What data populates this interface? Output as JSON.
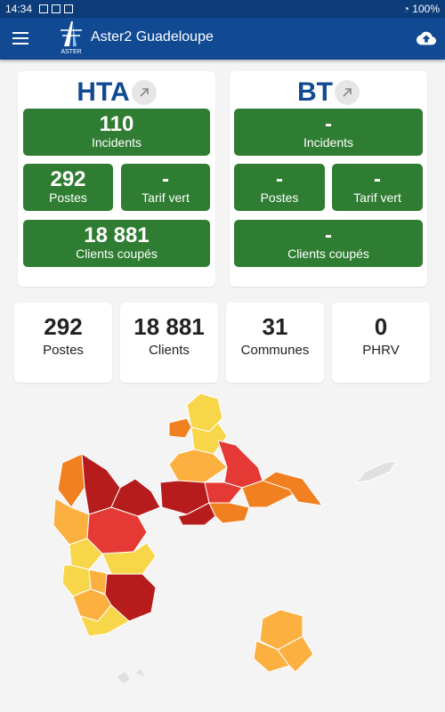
{
  "status_bar": {
    "time": "14:34",
    "battery": "100%"
  },
  "app": {
    "title": "Aster2  Guadeloupe",
    "logo_text": "ASTER"
  },
  "hta": {
    "title": "HTA",
    "incidents": {
      "value": "110",
      "label": "Incidents"
    },
    "postes": {
      "value": "292",
      "label": "Postes"
    },
    "tarif_vert": {
      "value": "-",
      "label": "Tarif vert"
    },
    "clients_coupes": {
      "value": "18 881",
      "label": "Clients coupés"
    }
  },
  "bt": {
    "title": "BT",
    "incidents": {
      "value": "-",
      "label": "Incidents"
    },
    "postes": {
      "value": "-",
      "label": "Postes"
    },
    "tarif_vert": {
      "value": "-",
      "label": "Tarif vert"
    },
    "clients_coupes": {
      "value": "-",
      "label": "Clients coupés"
    }
  },
  "stats": [
    {
      "value": "292",
      "label": "Postes"
    },
    {
      "value": "18 881",
      "label": "Clients"
    },
    {
      "value": "31",
      "label": "Communes"
    },
    {
      "value": "0",
      "label": "PHRV"
    }
  ],
  "colors": {
    "appbar": "#114a93",
    "tile_green": "#2f7d32",
    "severity": [
      "#f8d64a",
      "#fbb040",
      "#f08020",
      "#e53935",
      "#b71c1c"
    ]
  },
  "icons": [
    "menu-icon",
    "upload-cloud-icon",
    "open-external-icon"
  ]
}
